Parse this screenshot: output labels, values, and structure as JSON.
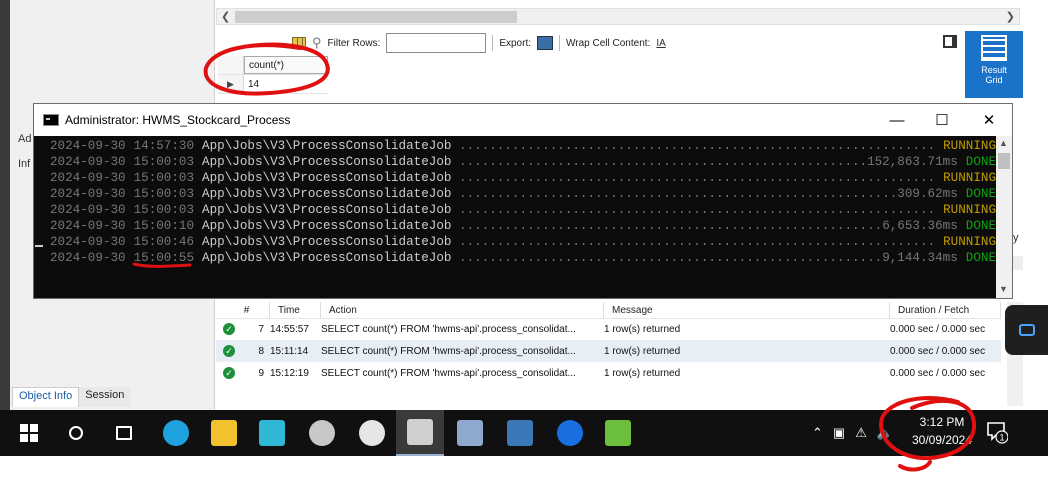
{
  "workbench": {
    "result_toolbar": {
      "filter_rows_label": "Filter Rows:",
      "filter_rows_value": "",
      "export_label": "Export:",
      "wrap_label": "Wrap Cell Content:",
      "wrap_icon_glyph": "IA"
    },
    "result_grid_button": {
      "line1": "Result",
      "line2": "Grid"
    },
    "mini_table": {
      "column": "count(*)",
      "value": "14"
    },
    "left_labels": [
      "Ad",
      "Inf"
    ],
    "right_edge_text": "y",
    "output_log": {
      "headers": [
        "#",
        "Time",
        "Action",
        "Message",
        "Duration / Fetch"
      ],
      "rows": [
        {
          "num": "7",
          "time": "14:55:57",
          "action": "SELECT count(*)  FROM 'hwms-api'.process_consolidat...",
          "message": "1 row(s) returned",
          "duration": "0.000 sec / 0.000 sec"
        },
        {
          "num": "8",
          "time": "15:11:14",
          "action": "SELECT count(*)  FROM 'hwms-api'.process_consolidat...",
          "message": "1 row(s) returned",
          "duration": "0.000 sec / 0.000 sec"
        },
        {
          "num": "9",
          "time": "15:12:19",
          "action": "SELECT count(*)  FROM 'hwms-api'.process_consolidat...",
          "message": "1 row(s) returned",
          "duration": "0.000 sec / 0.000 sec"
        }
      ]
    },
    "bottom_tabs": {
      "object_info": "Object Info",
      "session": "Session"
    }
  },
  "console": {
    "title": "Administrator:  HWMS_Stockcard_Process",
    "controls": {
      "minimize": "—",
      "maximize": "☐",
      "close": "✕"
    },
    "lines": [
      {
        "date": "2024-09-30",
        "time": "14:57:30",
        "job": "App\\Jobs\\V3\\ProcessConsolidateJob",
        "dots": " ..................................................................................",
        "duration": "",
        "status": "RUNNING"
      },
      {
        "date": "2024-09-30",
        "time": "15:00:03",
        "job": "App\\Jobs\\V3\\ProcessConsolidateJob",
        "dots": " ................................................................",
        "duration": "152,863.71ms",
        "status": "DONE"
      },
      {
        "date": "2024-09-30",
        "time": "15:00:03",
        "job": "App\\Jobs\\V3\\ProcessConsolidateJob",
        "dots": " ..................................................................................",
        "duration": "",
        "status": "RUNNING"
      },
      {
        "date": "2024-09-30",
        "time": "15:00:03",
        "job": "App\\Jobs\\V3\\ProcessConsolidateJob",
        "dots": " ......................................................................",
        "duration": "309.62ms",
        "status": "DONE"
      },
      {
        "date": "2024-09-30",
        "time": "15:00:03",
        "job": "App\\Jobs\\V3\\ProcessConsolidateJob",
        "dots": " ..................................................................................",
        "duration": "",
        "status": "RUNNING"
      },
      {
        "date": "2024-09-30",
        "time": "15:00:10",
        "job": "App\\Jobs\\V3\\ProcessConsolidateJob",
        "dots": " ....................................................................",
        "duration": "6,653.36ms",
        "status": "DONE"
      },
      {
        "date": "2024-09-30",
        "time": "15:00:46",
        "job": "App\\Jobs\\V3\\ProcessConsolidateJob",
        "dots": " ..................................................................................",
        "duration": "",
        "status": "RUNNING"
      },
      {
        "date": "2024-09-30",
        "time": "15:00:55",
        "job": "App\\Jobs\\V3\\ProcessConsolidateJob",
        "dots": " ....................................................................",
        "duration": "9,144.34ms",
        "status": "DONE"
      }
    ]
  },
  "taskbar": {
    "apps": [
      {
        "name": "start",
        "icon": "windows-logo-icon",
        "color": "#ffffff"
      },
      {
        "name": "search",
        "icon": "search-icon",
        "color": "#ffffff"
      },
      {
        "name": "task-view",
        "icon": "task-view-icon",
        "color": "#ffffff"
      },
      {
        "name": "edge",
        "icon": "edge-browser-icon",
        "color": "#1fa3e0"
      },
      {
        "name": "file-explorer",
        "icon": "folder-icon",
        "color": "#f2c12e"
      },
      {
        "name": "building-app",
        "icon": "building-icon",
        "color": "#2fb7d6"
      },
      {
        "name": "settings",
        "icon": "gear-icon",
        "color": "#c8c8c8"
      },
      {
        "name": "clock-app",
        "icon": "clock-icon",
        "color": "#e6e6e6"
      },
      {
        "name": "command-prompt",
        "icon": "cmd-icon",
        "color": "#cfcfcf"
      },
      {
        "name": "server-manager",
        "icon": "server-icon",
        "color": "#8ea8d0"
      },
      {
        "name": "mysql-workbench",
        "icon": "dolphin-icon",
        "color": "#3a78b8"
      },
      {
        "name": "teamviewer",
        "icon": "teamviewer-icon",
        "color": "#1a6fe0"
      },
      {
        "name": "notepad-app",
        "icon": "notepad-icon",
        "color": "#6cbf3a"
      }
    ],
    "clock": {
      "time": "3:12 PM",
      "date": "30/09/2024"
    },
    "notification_count": "1"
  },
  "annotations": {
    "color": "#e01010"
  }
}
